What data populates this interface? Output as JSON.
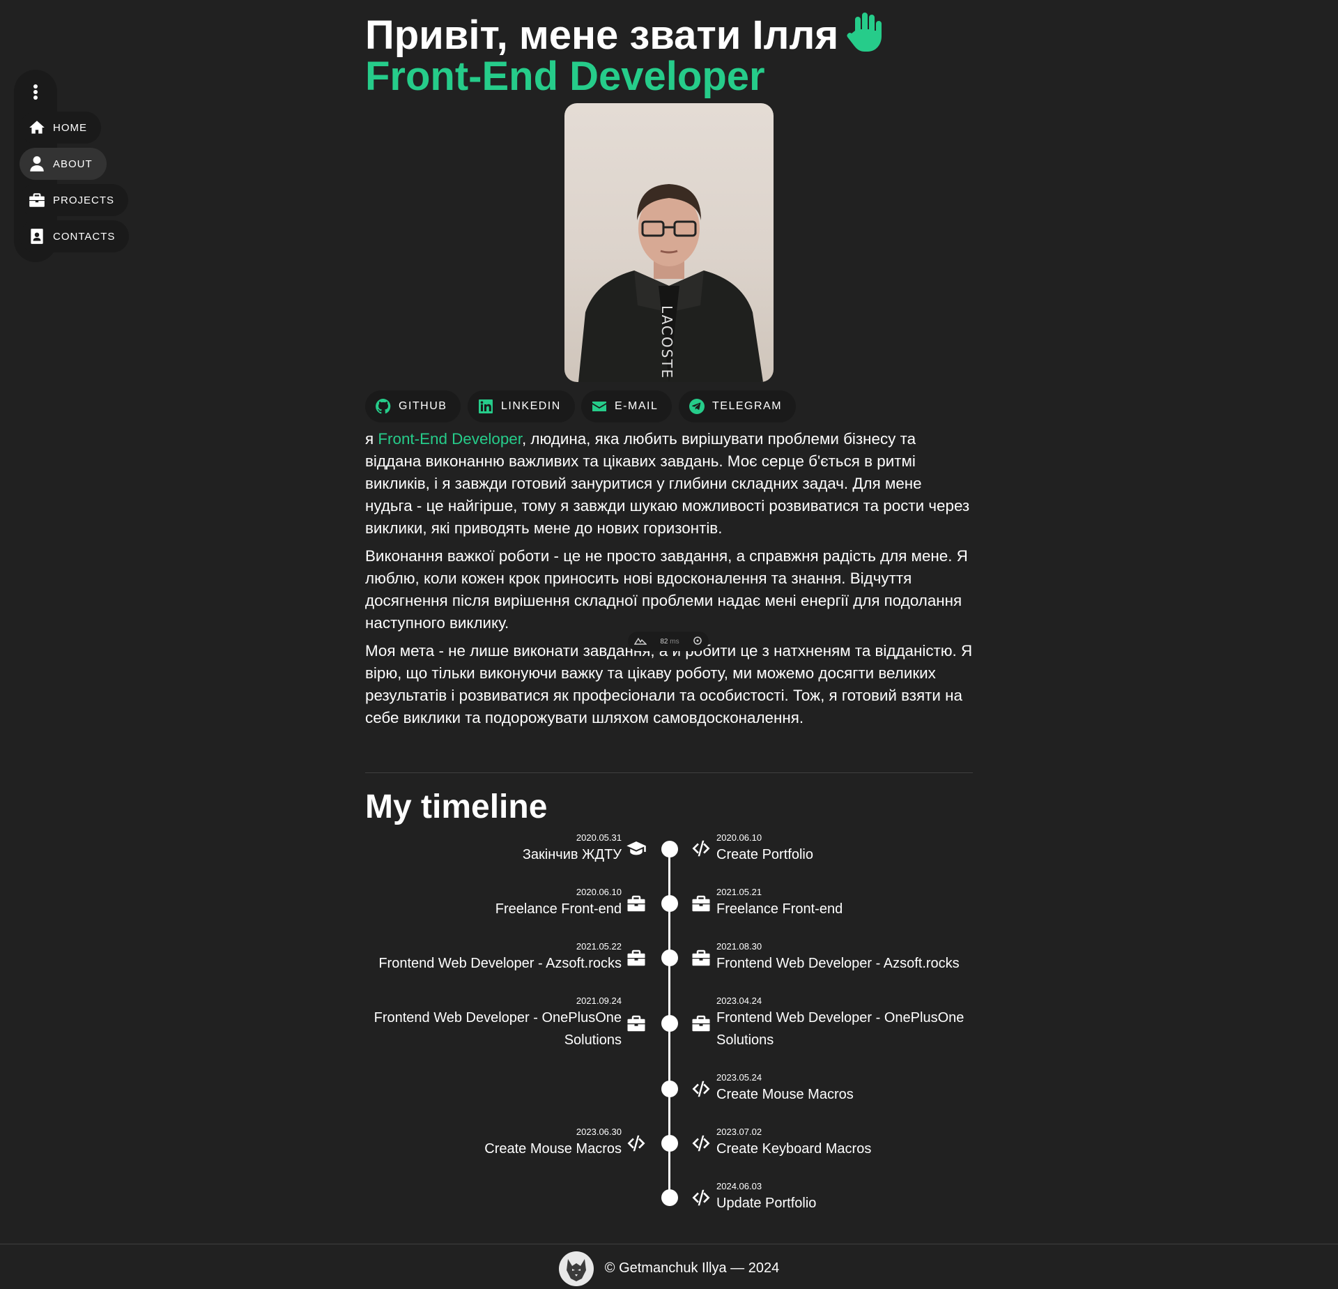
{
  "sidebar": {
    "menu_icon": "more-vertical-icon",
    "items": [
      {
        "label": "Home",
        "icon": "home-icon"
      },
      {
        "label": "About",
        "icon": "user-icon",
        "active": true
      },
      {
        "label": "Projects",
        "icon": "briefcase-icon"
      },
      {
        "label": "Contacts",
        "icon": "contact-card-icon"
      }
    ]
  },
  "hero": {
    "greeting": "Привіт, мене звати Ілля",
    "greeting_icon": "waving-hand-icon",
    "role": "Front-End Developer"
  },
  "socials": [
    {
      "label": "GitHub",
      "icon": "github-icon"
    },
    {
      "label": "LinkedIn",
      "icon": "linkedin-icon"
    },
    {
      "label": "E-mail",
      "icon": "mail-icon"
    },
    {
      "label": "Telegram",
      "icon": "telegram-icon"
    }
  ],
  "about": {
    "p1_prefix": "я ",
    "p1_highlight": "Front-End Developer",
    "p1_rest": ", людина, яка любить вирішувати проблеми бізнесу та віддана виконанню важливих та цікавих завдань. Моє серце б'ється в ритмі викликів, і я завжди готовий зануритися у глибини складних задач. Для мене нудьга - це найгірше, тому я завжди шукаю можливості розвиватися та рости через виклики, які приводять мене до нових горизонтів.",
    "p2": "Виконання важкої роботи - це не просто завдання, а справжня радість для мене. Я люблю, коли кожен крок приносить нові вдосконалення та знання. Відчуття досягнення після вирішення складної проблеми надає мені енергії для подолання наступного виклику.",
    "p3": "Моя мета - не лише виконати завдання, а й робити це з натхненям та відданістю. Я вірю, що тільки виконуючи важку та цікаву роботу, ми можемо досягти великих результатів і розвиватися як професіонали та особистості. Тож, я готовий взяти на себе виклики та подорожувати шляхом самовдосконалення."
  },
  "perf_widget": {
    "value": "82",
    "unit": "ms"
  },
  "timeline": {
    "title": "My timeline",
    "left": [
      {
        "date": "2020.05.31",
        "title": "Закінчив ЖДТУ",
        "icon": "graduation-cap-icon"
      },
      {
        "date": "2020.06.10",
        "title": "Freelance Front-end",
        "icon": "briefcase-icon"
      },
      {
        "date": "2021.05.22",
        "title": "Frontend Web Developer - Azsoft.rocks",
        "icon": "briefcase-icon"
      },
      {
        "date": "2021.09.24",
        "title": "Frontend Web Developer - OnePlusOne Solutions",
        "icon": "briefcase-icon"
      },
      {
        "date": "2023.06.30",
        "title": "Create Mouse Macros",
        "icon": "code-icon"
      }
    ],
    "right": [
      {
        "date": "2020.06.10",
        "title": "Create Portfolio",
        "icon": "code-icon"
      },
      {
        "date": "2021.05.21",
        "title": "Freelance Front-end",
        "icon": "briefcase-icon"
      },
      {
        "date": "2021.08.30",
        "title": "Frontend Web Developer - Azsoft.rocks",
        "icon": "briefcase-icon"
      },
      {
        "date": "2023.04.24",
        "title": "Frontend Web Developer - OnePlusOne Solutions",
        "icon": "briefcase-icon"
      },
      {
        "date": "2023.05.24",
        "title": "Create Mouse Macros",
        "icon": "code-icon"
      },
      {
        "date": "2023.07.02",
        "title": "Create Keyboard Macros",
        "icon": "code-icon"
      },
      {
        "date": "2024.06.03",
        "title": "Update Portfolio",
        "icon": "code-icon"
      }
    ]
  },
  "footer": {
    "logo_icon": "wolf-logo-icon",
    "copyright": "© Getmanchuk Illya — 2024"
  },
  "colors": {
    "background": "#212121",
    "accent": "#26cc8a",
    "nav_bg": "#1a1a1a",
    "nav_active_bg": "#333333"
  }
}
